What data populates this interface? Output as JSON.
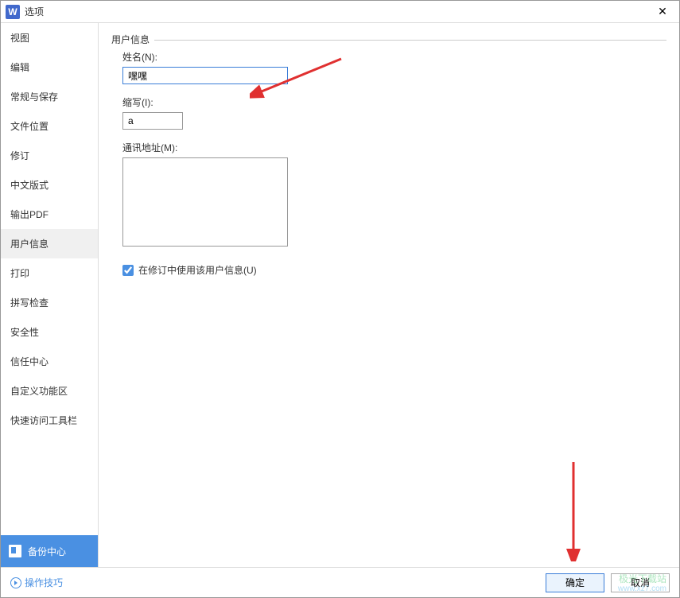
{
  "titlebar": {
    "icon_letter": "W",
    "title": "选项"
  },
  "sidebar": {
    "items": [
      {
        "label": "视图"
      },
      {
        "label": "编辑"
      },
      {
        "label": "常规与保存"
      },
      {
        "label": "文件位置"
      },
      {
        "label": "修订"
      },
      {
        "label": "中文版式"
      },
      {
        "label": "输出PDF"
      },
      {
        "label": "用户信息"
      },
      {
        "label": "打印"
      },
      {
        "label": "拼写检查"
      },
      {
        "label": "安全性"
      },
      {
        "label": "信任中心"
      },
      {
        "label": "自定义功能区"
      },
      {
        "label": "快速访问工具栏"
      }
    ],
    "active_index": 7,
    "backup_center": "备份中心"
  },
  "content": {
    "section_title": "用户信息",
    "name_label": "姓名(N):",
    "name_value": "嘿嘿",
    "initials_label": "缩写(I):",
    "initials_value": "a",
    "address_label": "通讯地址(M):",
    "address_value": "",
    "use_in_revision_label": "在修订中使用该用户信息(U)",
    "use_in_revision_checked": true
  },
  "footer": {
    "tips": "操作技巧",
    "ok": "确定",
    "cancel": "取消"
  },
  "watermark": {
    "line1": "极光下载站",
    "line2": "www.xz7.com"
  }
}
